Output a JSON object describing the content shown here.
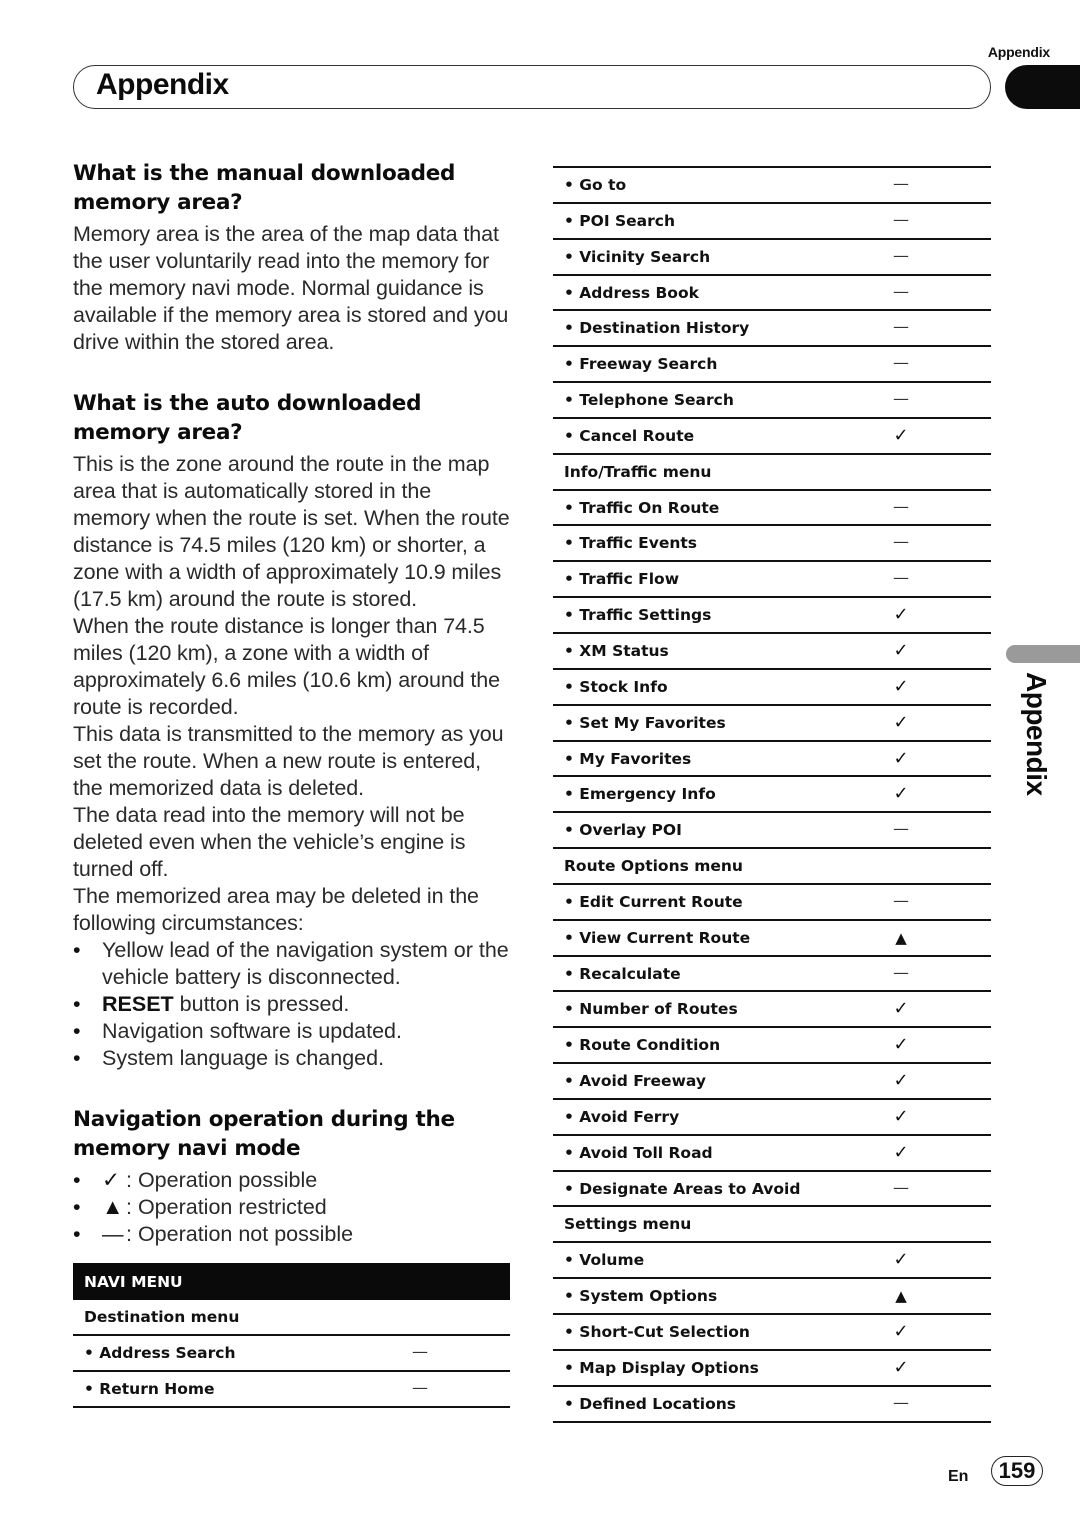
{
  "header": {
    "running_title": "Appendix",
    "chapter_title": "Appendix"
  },
  "side_tab": {
    "label": "Appendix"
  },
  "sections": [
    {
      "heading": "What is the manual downloaded memory area?",
      "paragraphs": [
        "Memory area is the area of the map data that the user voluntarily read into the memory for the memory navi mode. Normal guidance is available if the memory area is stored and you drive within the stored area."
      ]
    },
    {
      "heading": "What is the auto downloaded memory area?",
      "paragraphs": [
        "This is the zone around the route in the map area that is automatically stored in the memory when the route is set. When the route distance is 74.5 miles (120 km) or shorter, a zone with a width of approximately 10.9 miles (17.5 km) around the route is stored.",
        "When the route distance is longer than 74.5 miles (120 km), a zone with a width of approximately 6.6 miles (10.6 km) around the route is recorded.",
        "This data is transmitted to the memory as you set the route. When a new route is entered, the memorized data is deleted.",
        "The data read into the memory will not be deleted even when the vehicle’s engine is turned off.",
        "The memorized area may be deleted in the following circumstances:"
      ],
      "bullets": [
        {
          "bold": "",
          "text": "Yellow lead of the navigation system or the vehicle battery is disconnected."
        },
        {
          "bold": "RESET",
          "text": " button is pressed."
        },
        {
          "bold": "",
          "text": "Navigation software is updated."
        },
        {
          "bold": "",
          "text": "System language is changed."
        }
      ]
    },
    {
      "heading": "Navigation operation during the memory navi mode",
      "legend": [
        {
          "symbol": "✓",
          "text": ": Operation possible"
        },
        {
          "symbol": "▲",
          "text": ": Operation restricted"
        },
        {
          "symbol": "—",
          "text": ": Operation not possible"
        }
      ]
    }
  ],
  "bullet_char": "•",
  "navi_table": {
    "header": "NAVI MENU",
    "left_rows": [
      {
        "type": "group",
        "label": "Destination menu"
      },
      {
        "type": "item",
        "label": "• Address Search",
        "value": "—"
      },
      {
        "type": "item",
        "label": "• Return Home",
        "value": "—"
      }
    ],
    "right_rows": [
      {
        "type": "item",
        "label": "• Go to",
        "value": "—"
      },
      {
        "type": "item",
        "label": "• POI Search",
        "value": "—"
      },
      {
        "type": "item",
        "label": "• Vicinity Search",
        "value": "—"
      },
      {
        "type": "item",
        "label": "• Address Book",
        "value": "—"
      },
      {
        "type": "item",
        "label": "• Destination History",
        "value": "—"
      },
      {
        "type": "item",
        "label": "• Freeway Search",
        "value": "—"
      },
      {
        "type": "item",
        "label": "• Telephone Search",
        "value": "—"
      },
      {
        "type": "item",
        "label": "• Cancel Route",
        "value": "✓"
      },
      {
        "type": "group",
        "label": "Info/Traffic menu"
      },
      {
        "type": "item",
        "label": "• Traffic On Route",
        "value": "—"
      },
      {
        "type": "item",
        "label": "• Traffic Events",
        "value": "—"
      },
      {
        "type": "item",
        "label": "• Traffic Flow",
        "value": "—"
      },
      {
        "type": "item",
        "label": "• Traffic Settings",
        "value": "✓"
      },
      {
        "type": "item",
        "label": "• XM Status",
        "value": "✓"
      },
      {
        "type": "item",
        "label": "• Stock Info",
        "value": "✓"
      },
      {
        "type": "item",
        "label": "• Set My Favorites",
        "value": "✓"
      },
      {
        "type": "item",
        "label": "• My Favorites",
        "value": "✓"
      },
      {
        "type": "item",
        "label": "• Emergency Info",
        "value": "✓"
      },
      {
        "type": "item",
        "label": "• Overlay POI",
        "value": "—"
      },
      {
        "type": "group",
        "label": "Route Options menu"
      },
      {
        "type": "item",
        "label": "• Edit Current Route",
        "value": "—"
      },
      {
        "type": "item",
        "label": "• View Current Route",
        "value": "▲"
      },
      {
        "type": "item",
        "label": "• Recalculate",
        "value": "—"
      },
      {
        "type": "item",
        "label": "• Number of Routes",
        "value": "✓"
      },
      {
        "type": "item",
        "label": "• Route Condition",
        "value": "✓"
      },
      {
        "type": "item",
        "label": "• Avoid Freeway",
        "value": "✓"
      },
      {
        "type": "item",
        "label": "• Avoid Ferry",
        "value": "✓"
      },
      {
        "type": "item",
        "label": "• Avoid Toll Road",
        "value": "✓"
      },
      {
        "type": "item",
        "label": "• Designate Areas to Avoid",
        "value": "—"
      },
      {
        "type": "group",
        "label": "Settings menu"
      },
      {
        "type": "item",
        "label": "• Volume",
        "value": "✓"
      },
      {
        "type": "item",
        "label": "• System Options",
        "value": "▲"
      },
      {
        "type": "item",
        "label": "• Short-Cut Selection",
        "value": "✓"
      },
      {
        "type": "item",
        "label": "• Map Display Options",
        "value": "✓"
      },
      {
        "type": "item",
        "label": "• Defined Locations",
        "value": "—"
      }
    ]
  },
  "footer": {
    "language": "En",
    "page_number": "159"
  }
}
